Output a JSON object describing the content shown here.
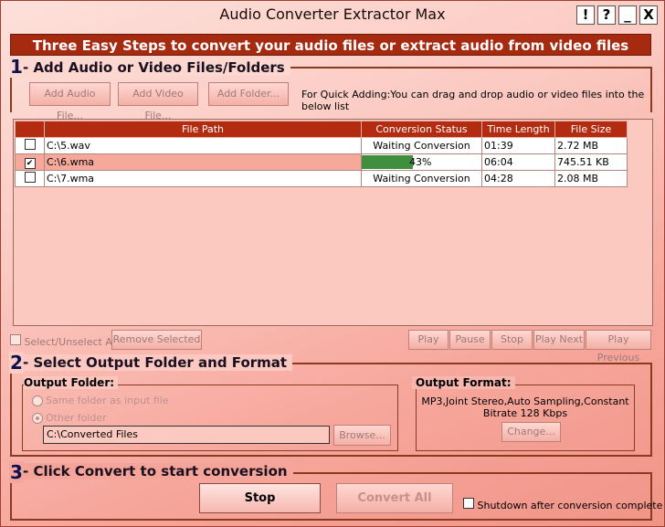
{
  "window": {
    "title": "Audio Converter Extractor Max",
    "controls": [
      "!",
      "?",
      "_",
      "X"
    ]
  },
  "banner": "Three Easy Steps to convert your audio files or extract audio from video files",
  "step1": {
    "number": "1",
    "title": "- Add Audio or Video Files/Folders",
    "add_audio": "Add Audio File...",
    "add_video": "Add Video File...",
    "add_folder": "Add Folder...",
    "hint": "For Quick Adding:You can drag and drop audio or video files into the below list"
  },
  "table": {
    "columns": [
      "File Path",
      "Conversion Status",
      "Time Length",
      "File Size"
    ],
    "rows": [
      {
        "checked": false,
        "path": "C:\\5.wav",
        "status": "Waiting Conversion",
        "progress": null,
        "time": "01:39",
        "size": "2.72 MB"
      },
      {
        "checked": true,
        "path": "C:\\6.wma",
        "status": "43%",
        "progress": 0.43,
        "time": "06:04",
        "size": "745.51 KB"
      },
      {
        "checked": false,
        "path": "C:\\7.wma",
        "status": "Waiting Conversion",
        "progress": null,
        "time": "04:28",
        "size": "2.08 MB"
      }
    ]
  },
  "list_controls": {
    "select_all": "Select/Unselect All",
    "remove_selected": "Remove Selected",
    "play": "Play",
    "pause": "Pause",
    "stop": "Stop",
    "play_next": "Play Next",
    "play_previous": "Play Previous"
  },
  "step2": {
    "number": "2",
    "title": "- Select Output Folder and Format",
    "output_folder_label": "Output Folder:",
    "same_folder": "Same folder as input file",
    "other_folder": "Other folder",
    "folder_path": "C:\\Converted Files",
    "browse": "Browse...",
    "output_format_label": "Output Format:",
    "format_line1": "MP3,Joint Stereo,Auto Sampling,Constant",
    "format_line2": "Bitrate 128 Kbps",
    "change": "Change..."
  },
  "step3": {
    "number": "3",
    "title": "- Click Convert to start conversion",
    "stop": "Stop",
    "convert_all": "Convert All",
    "shutdown": "Shutdown after conversion complete"
  }
}
